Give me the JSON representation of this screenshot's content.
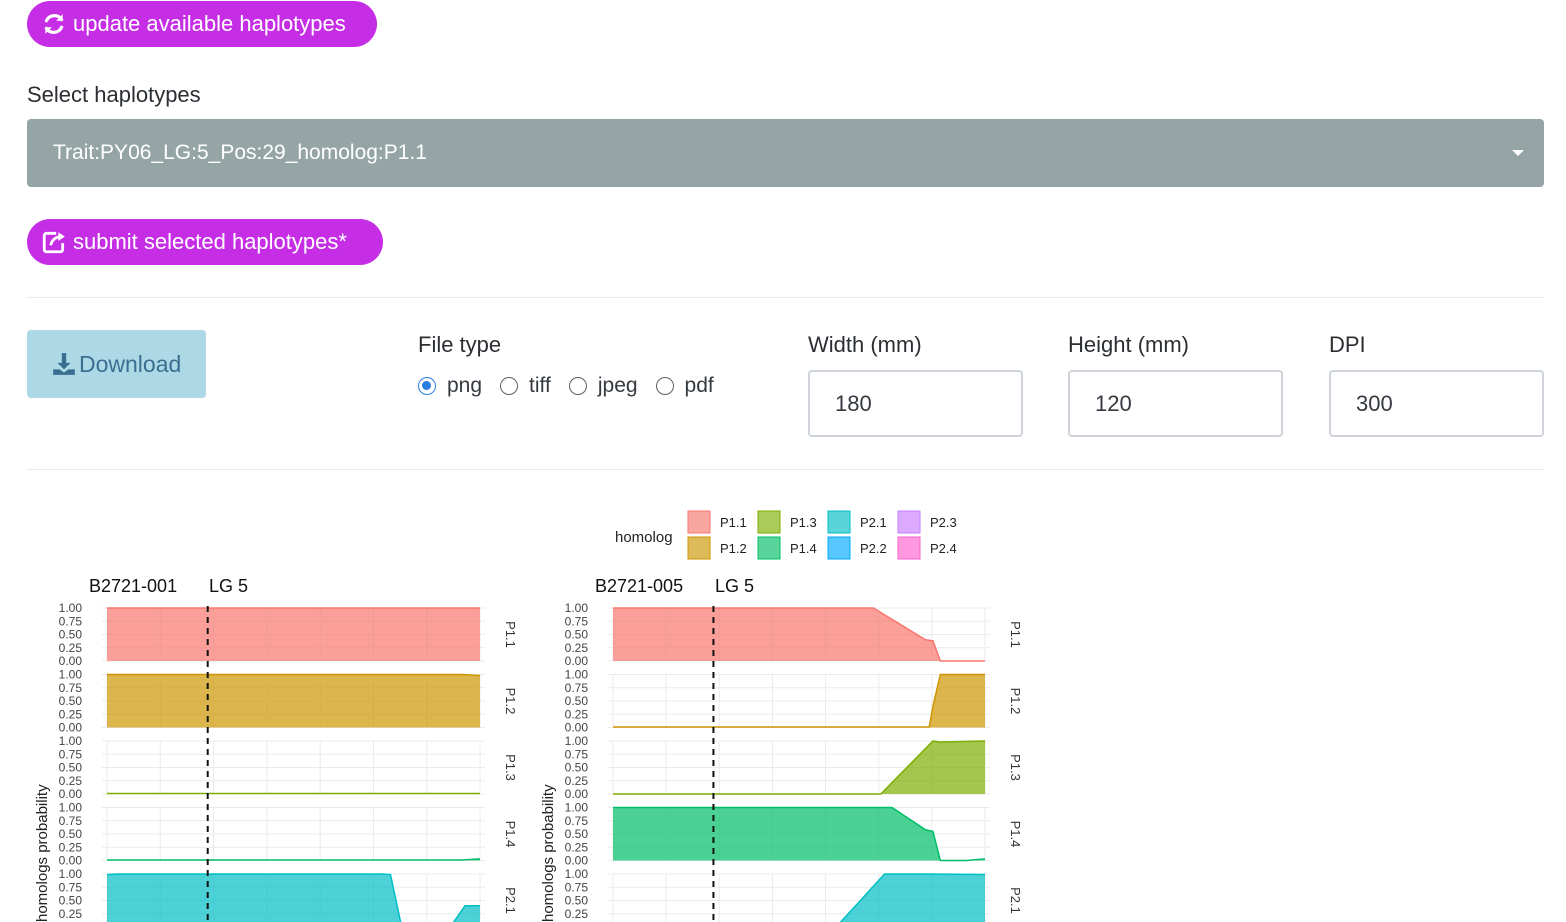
{
  "buttons": {
    "update_label": "update available haplotypes",
    "submit_label": "submit selected haplotypes*",
    "download_label": "Download"
  },
  "haplotypes": {
    "label": "Select haplotypes",
    "selected": "Trait:PY06_LG:5_Pos:29_homolog:P1.1"
  },
  "export": {
    "file_type_label": "File type",
    "file_types": [
      "png",
      "tiff",
      "jpeg",
      "pdf"
    ],
    "selected_file_type": "png",
    "width_label": "Width (mm)",
    "width_value": "180",
    "height_label": "Height (mm)",
    "height_value": "120",
    "dpi_label": "DPI",
    "dpi_value": "300"
  },
  "colors": {
    "accent": "#c62ee6",
    "select_bg": "#95a5a6",
    "download_bg": "#add8e6",
    "P1.1": "#f8766d",
    "P1.2": "#cd9600",
    "P1.3": "#7cae00",
    "P1.4": "#00be67",
    "P2.1": "#00bfc4",
    "P2.2": "#00a9ff",
    "P2.3": "#c77cff",
    "P2.4": "#ff61cc"
  },
  "chart_data": {
    "type": "area",
    "legend_title": "homolog",
    "legend_entries": [
      "P1.1",
      "P1.2",
      "P1.3",
      "P1.4",
      "P2.1",
      "P2.2",
      "P2.3",
      "P2.4"
    ],
    "legend_placement": "top",
    "ylabel": "homologs probability",
    "y_ticks": [
      "1.00",
      "0.75",
      "0.50",
      "0.25",
      "0.00"
    ],
    "ylim": [
      0,
      1
    ],
    "xlim": [
      0,
      1
    ],
    "panels": [
      {
        "individual": "B2721-001",
        "lg": "LG 5",
        "qtl_x": 0.27,
        "series": [
          {
            "name": "P1.1",
            "x": [
              0,
              1
            ],
            "y": [
              1,
              1
            ]
          },
          {
            "name": "P1.2",
            "x": [
              0,
              0.95,
              1
            ],
            "y": [
              1,
              1,
              0.98
            ]
          },
          {
            "name": "P1.3",
            "x": [
              0,
              1
            ],
            "y": [
              0.01,
              0.01
            ]
          },
          {
            "name": "P1.4",
            "x": [
              0,
              0.95,
              1
            ],
            "y": [
              0.01,
              0.01,
              0.03
            ]
          },
          {
            "name": "P2.1",
            "x": [
              0,
              0.03,
              0.74,
              0.76,
              0.79,
              0.92,
              0.96,
              0.99,
              1
            ],
            "y": [
              0.99,
              1,
              1,
              0.99,
              0,
              0,
              0.4,
              0.4,
              0.4
            ]
          }
        ]
      },
      {
        "individual": "B2721-005",
        "lg": "LG 5",
        "qtl_x": 0.27,
        "series": [
          {
            "name": "P1.1",
            "x": [
              0,
              0.7,
              0.84,
              0.86,
              0.88,
              1
            ],
            "y": [
              1,
              1,
              0.4,
              0.38,
              0,
              0
            ]
          },
          {
            "name": "P1.2",
            "x": [
              0,
              0.85,
              0.86,
              0.88,
              1
            ],
            "y": [
              0.01,
              0.01,
              0.4,
              1,
              1
            ]
          },
          {
            "name": "P1.3",
            "x": [
              0,
              0.72,
              0.86,
              0.88,
              1
            ],
            "y": [
              0,
              0,
              1,
              0.98,
              1
            ]
          },
          {
            "name": "P1.4",
            "x": [
              0,
              0.75,
              0.84,
              0.86,
              0.88,
              0.95,
              1
            ],
            "y": [
              1,
              1,
              0.58,
              0.55,
              0,
              0,
              0.03
            ]
          },
          {
            "name": "P2.1",
            "x": [
              0,
              0.6,
              0.73,
              0.84,
              1
            ],
            "y": [
              0,
              0,
              1,
              1,
              0.99
            ]
          }
        ]
      }
    ]
  }
}
